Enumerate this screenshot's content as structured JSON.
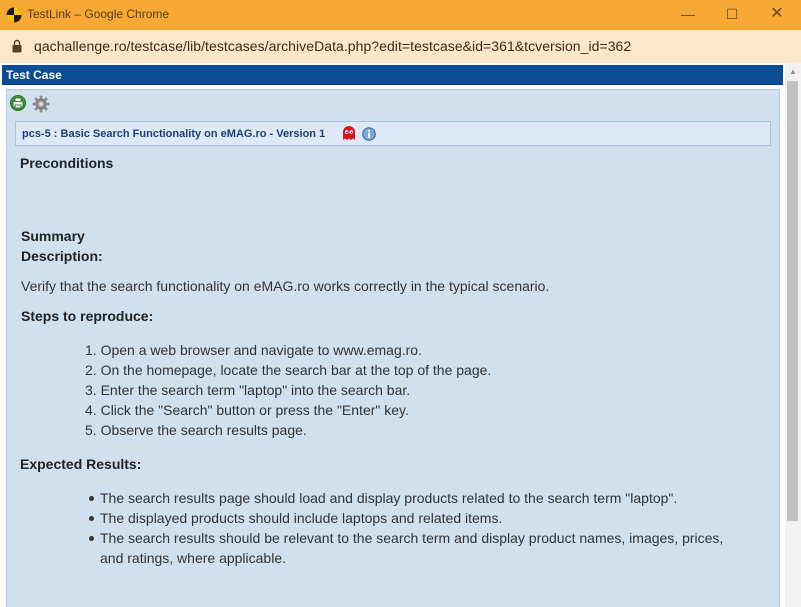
{
  "window": {
    "title": "TestLink – Google Chrome",
    "minimize_glyph": "—",
    "maximize_glyph": "☐",
    "close_glyph": "✕"
  },
  "address": {
    "url": "qachallenge.ro/testcase/lib/testcases/archiveData.php?edit=testcase&id=361&tcversion_id=362"
  },
  "header": {
    "title": "Test Case"
  },
  "testcase": {
    "title": "pcs-5 : Basic Search Functionality on eMAG.ro - Version 1",
    "preconditions_label": "Preconditions",
    "summary_label": "Summary",
    "description_label": "Description:",
    "description_text": "Verify that the search functionality on eMAG.ro works correctly in the typical scenario.",
    "steps_label": "Steps to reproduce:",
    "steps": [
      "Open a web browser and navigate to www.emag.ro.",
      "On the homepage, locate the search bar at the top of the page.",
      "Enter the search term \"laptop\" into the search bar.",
      "Click the \"Search\" button or press the \"Enter\" key.",
      "Observe the search results page."
    ],
    "expected_label": "Expected Results:",
    "expected": [
      "The search results page should load and display products related to the search term \"laptop\".",
      "The displayed products should include laptops and related items.",
      "The search results should be relevant to the search term and display product names, images, prices,",
      "and ratings, where applicable."
    ]
  },
  "colors": {
    "titlebar": "#f8a834",
    "addressbar": "#fde7cb",
    "header": "#0b4d93",
    "panel": "#d1e0ef"
  },
  "icons": [
    "app-icon",
    "lock-icon",
    "export-icon",
    "settings-icon",
    "ghost-icon",
    "info-icon"
  ]
}
